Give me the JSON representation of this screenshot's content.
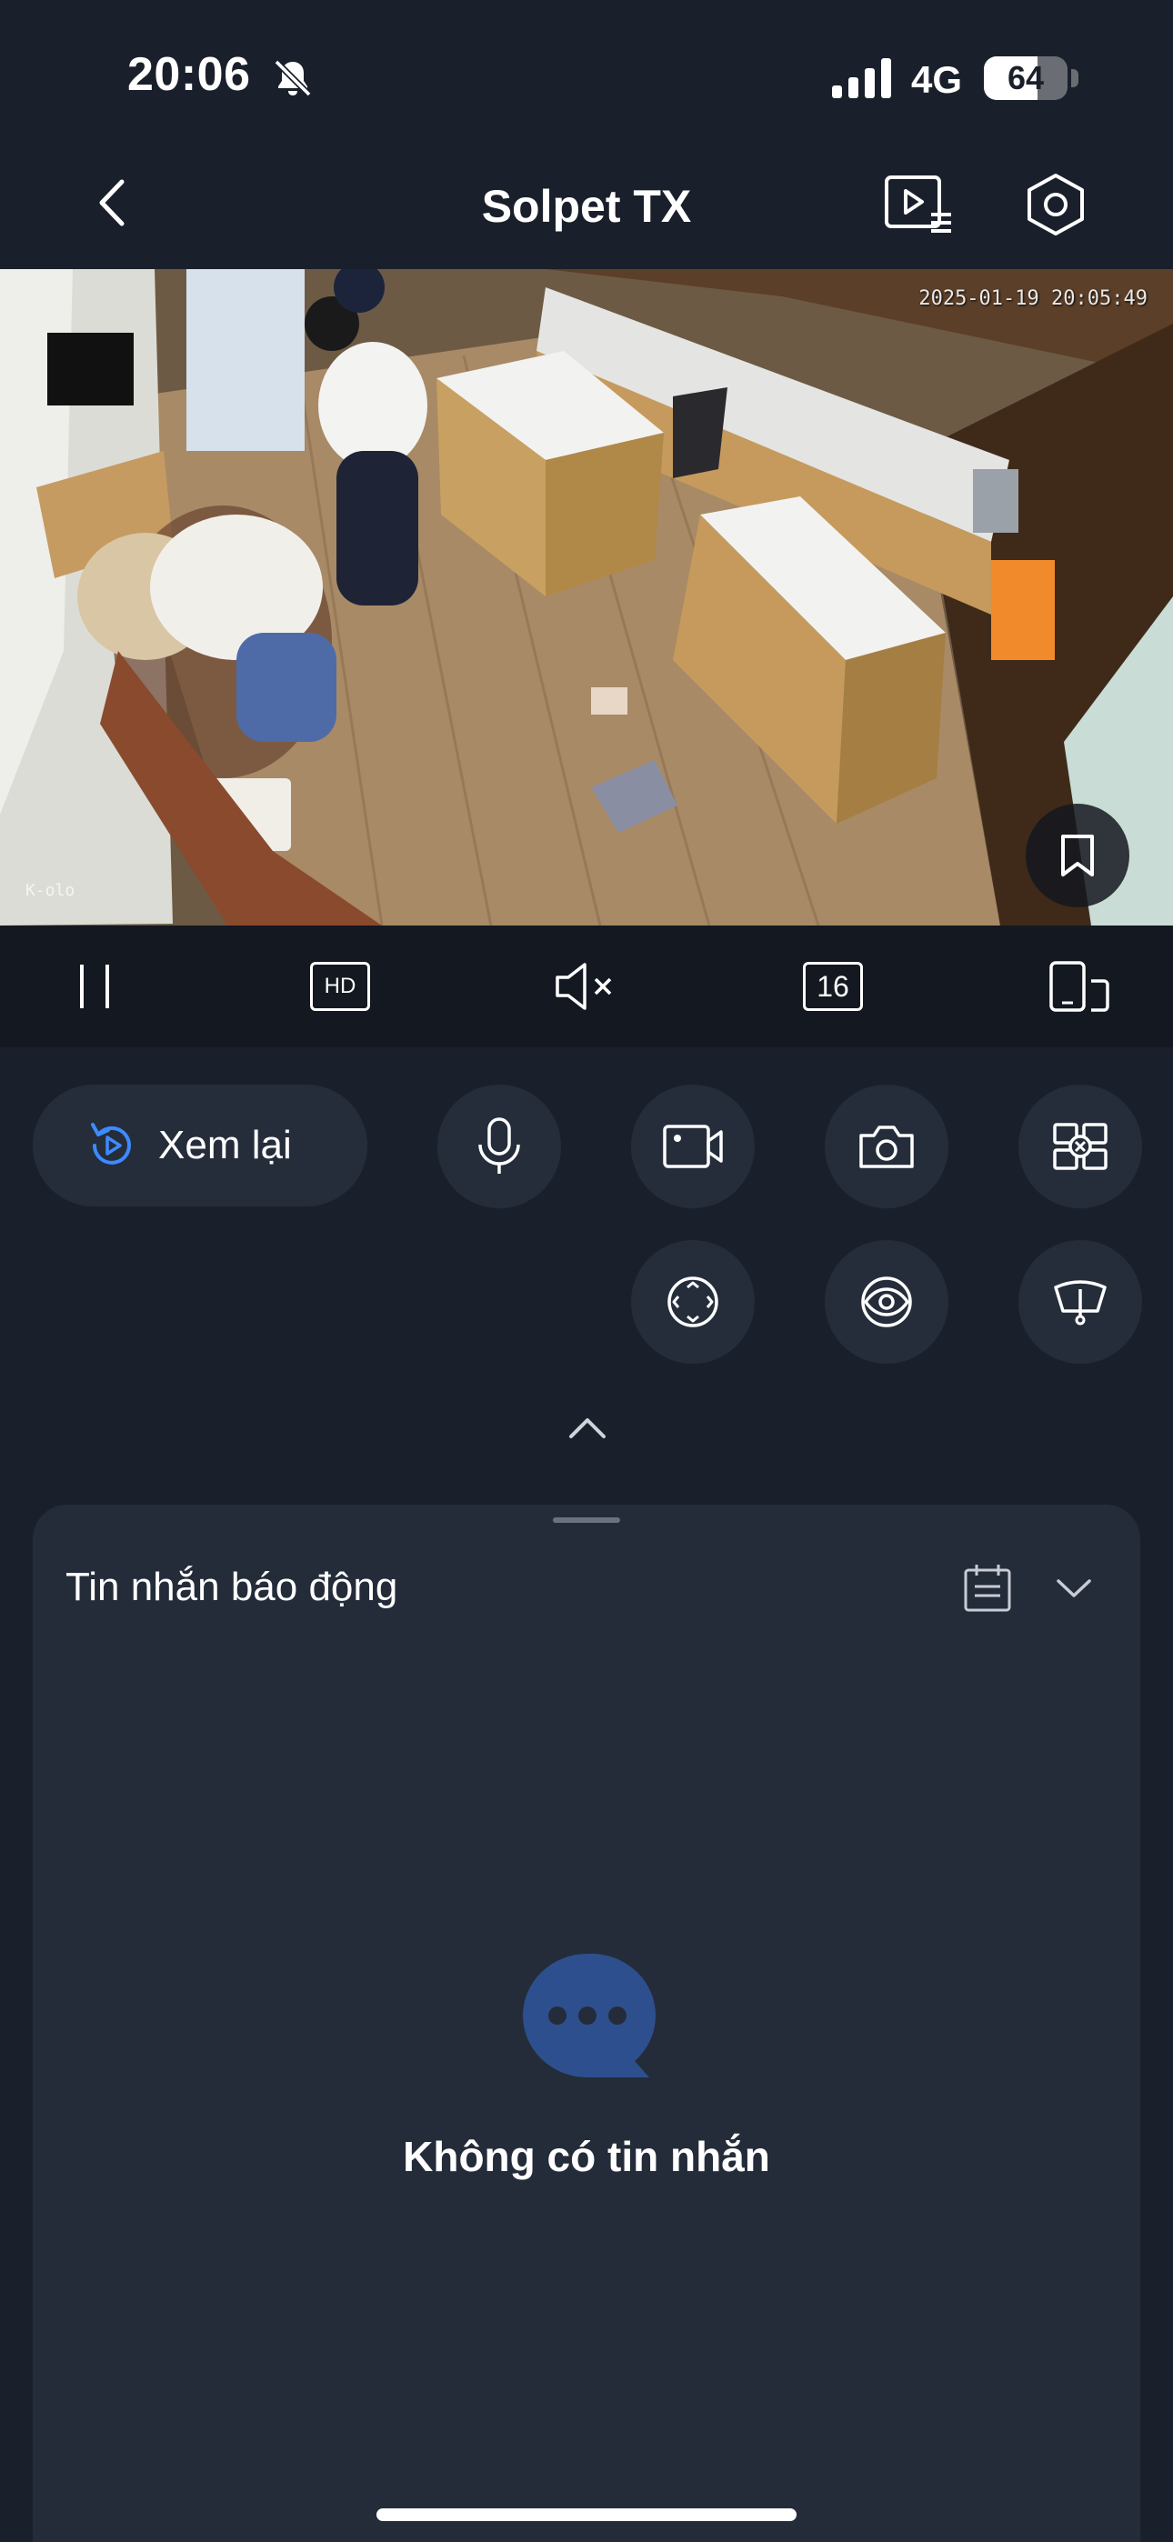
{
  "status_bar": {
    "time": "20:06",
    "network": "4G",
    "battery_percent": "64",
    "battery_level": 0.64,
    "icons": [
      "bell-slash-icon",
      "cellular-signal-icon",
      "battery-icon"
    ]
  },
  "nav": {
    "title": "Solpet TX",
    "icons": [
      "chevron-left-icon",
      "playback-list-icon",
      "settings-hexagon-icon"
    ]
  },
  "video": {
    "timestamp": "2025-01-19 20:05:49",
    "watermark": "K-olo",
    "icons": [
      "bookmark-icon"
    ]
  },
  "player_toolbar": {
    "quality_label": "HD",
    "split_count_label": "16",
    "icons": [
      "pause-icon",
      "hd-icon",
      "speaker-muted-icon",
      "split-16-icon",
      "rotate-device-icon"
    ]
  },
  "controls": {
    "replay_label": "Xem lại",
    "icons": [
      "replay-icon",
      "microphone-icon",
      "video-record-icon",
      "camera-icon",
      "multi-screen-icon",
      "ptz-icon",
      "privacy-eye-icon",
      "wiper-icon",
      "chevron-up-icon"
    ]
  },
  "alarm_panel": {
    "title": "Tin nhắn báo động",
    "empty_message": "Không có tin nhắn",
    "icons": [
      "calendar-icon",
      "chevron-down-icon",
      "chat-bubble-icon"
    ]
  },
  "colors": {
    "background": "#1a202b",
    "toolbar": "#141820",
    "button_bg": "#252d3b",
    "panel_bg": "#242c3a",
    "accent": "#3d8bff",
    "empty_icon": "#2e4f8e"
  }
}
